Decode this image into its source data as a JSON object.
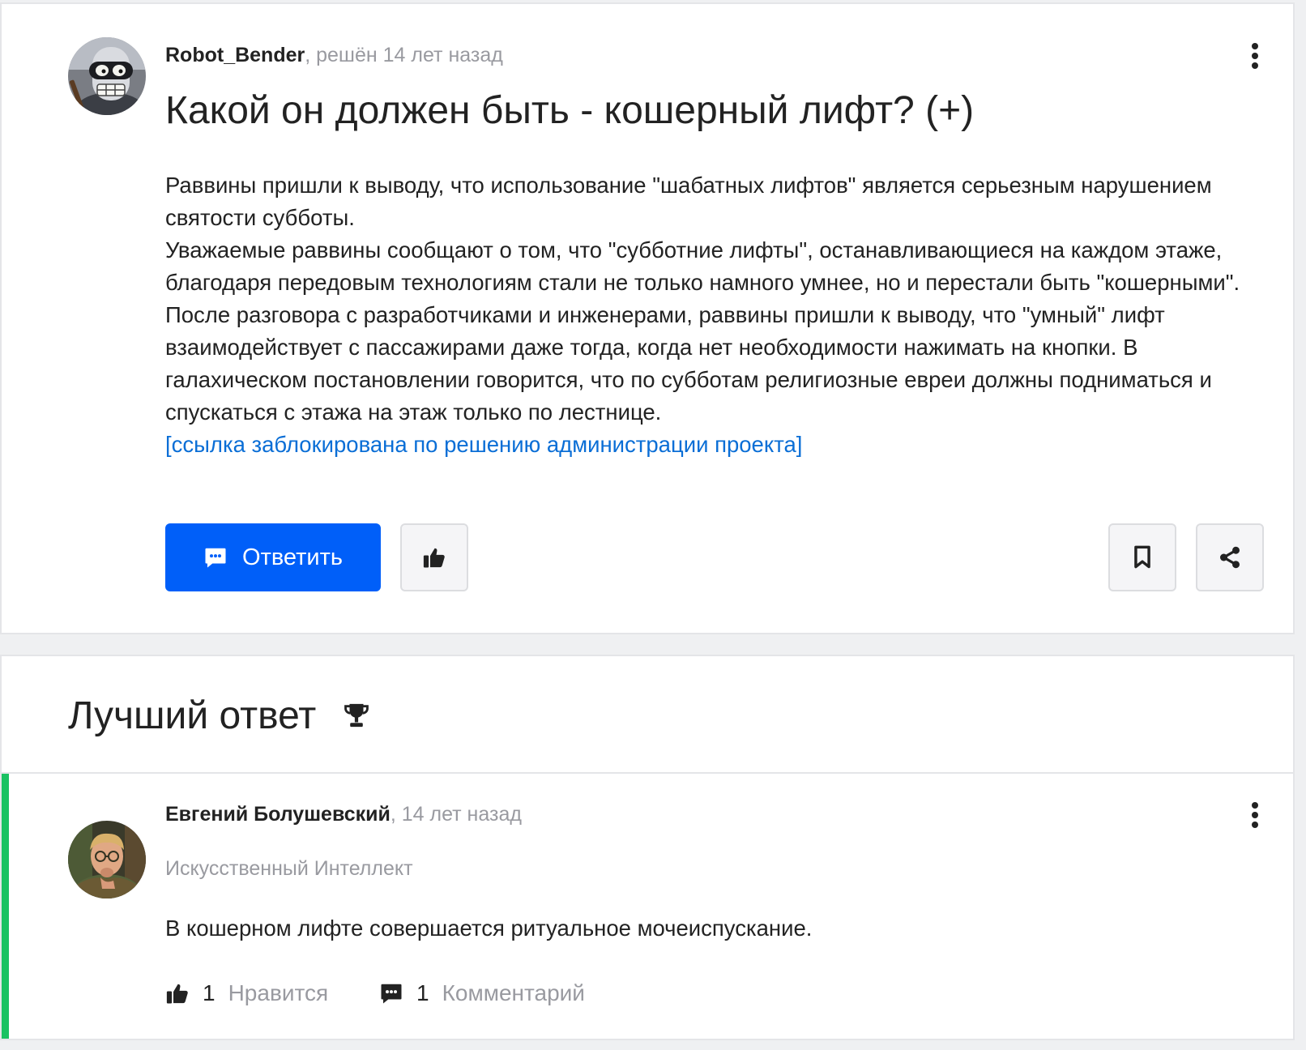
{
  "question": {
    "author": "Robot_Bender",
    "meta": ", решён 14 лет назад",
    "title": "Какой он должен быть - кошерный лифт? (+)",
    "body": [
      "Раввины пришли к выводу, что использование \"шабатных лифтов\" является серьезным нарушением святости субботы.",
      "Уважаемые раввины сообщают о том, что \"субботние лифты\", останавливающиеся на каждом этаже, благодаря передовым технологиям стали не только намного умнее, но и перестали быть \"кошерными\". После разговора с разработчиками и инженерами, раввины пришли к выводу, что \"умный\" лифт взаимодействует с пассажирами даже тогда, когда нет необходимости нажимать на кнопки. В галахическом постановлении говорится, что по субботам религиозные евреи должны подниматься и спускаться с этажа на этаж только по лестнице."
    ],
    "link": "[ссылка заблокирована по решению администрации проекта]",
    "reply_label": "Ответить",
    "icons": {
      "avatar": "robot-avatar",
      "menu": "more-vertical-icon",
      "reply": "comment-icon",
      "like": "thumbs-up-icon",
      "bookmark": "bookmark-icon",
      "share": "share-icon"
    }
  },
  "best_answer": {
    "heading": "Лучший ответ",
    "heading_icon": "trophy-icon",
    "author": "Евгений Болушевский",
    "meta": ", 14 лет назад",
    "status": "Искусственный Интеллект",
    "text": "В кошерном лифте совершается ритуальное мочеиспускание.",
    "likes_count": "1",
    "likes_label": "Нравится",
    "comments_count": "1",
    "comments_label": "Комментарий"
  },
  "colors": {
    "primary": "#005ff9",
    "link": "#0a6ed6",
    "best_accent": "#1ac262",
    "muted_text": "#999aa0",
    "page_background": "#eff0f2"
  }
}
